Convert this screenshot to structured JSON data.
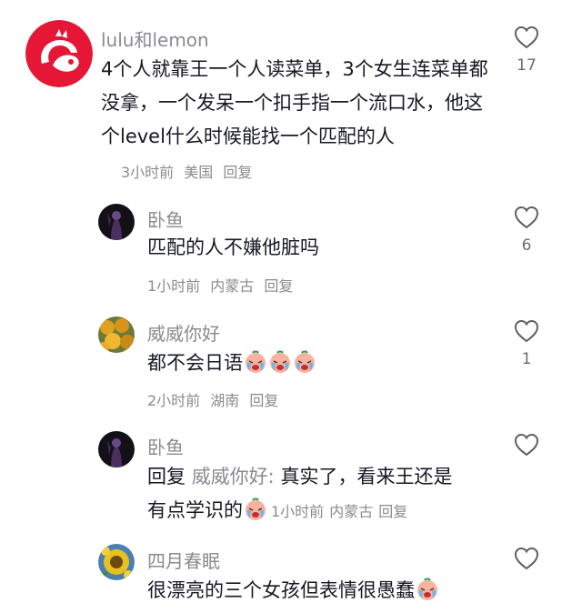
{
  "comments": [
    {
      "username": "lulu和lemon",
      "text": "4个人就靠王一个人读菜单，3个女生连菜单都没拿，一个发呆一个扣手指一个流口水，他这个level什么时候能找一个匹配的人",
      "time": "3小时前",
      "location": "美国",
      "reply_label": "回复",
      "likes": "17",
      "avatar_icon": "chick-fil-a-logo-icon"
    },
    {
      "username": "卧鱼",
      "text": "匹配的人不嫌他脏吗",
      "time": "1小时前",
      "location": "内蒙古",
      "reply_label": "回复",
      "likes": "6",
      "avatar_icon": "dark-figure-avatar-icon"
    },
    {
      "username": "威威你好",
      "text": "都不会日语",
      "emoji_name": "crying-face-emoji",
      "time": "2小时前",
      "location": "湖南",
      "reply_label": "回复",
      "likes": "1",
      "avatar_icon": "fruit-avatar-icon"
    },
    {
      "username": "卧鱼",
      "reply_prefix": "回复",
      "mention": "威威你好:",
      "text_line1": "真实了，看来王还是",
      "text_line2": "有点学识的",
      "emoji_name": "crying-face-emoji",
      "time": "1小时前",
      "location": "内蒙古",
      "reply_label": "回复",
      "likes": "",
      "avatar_icon": "dark-figure-avatar-icon"
    },
    {
      "username": "四月春眠",
      "text": "很漂亮的三个女孩但表情很愚蠢",
      "emoji_name": "crying-face-emoji",
      "likes": "",
      "avatar_icon": "yellow-flower-avatar-icon"
    }
  ],
  "colors": {
    "brand_red": "#e51636",
    "meta_gray": "#8a8b91",
    "text_dark": "#161823"
  }
}
